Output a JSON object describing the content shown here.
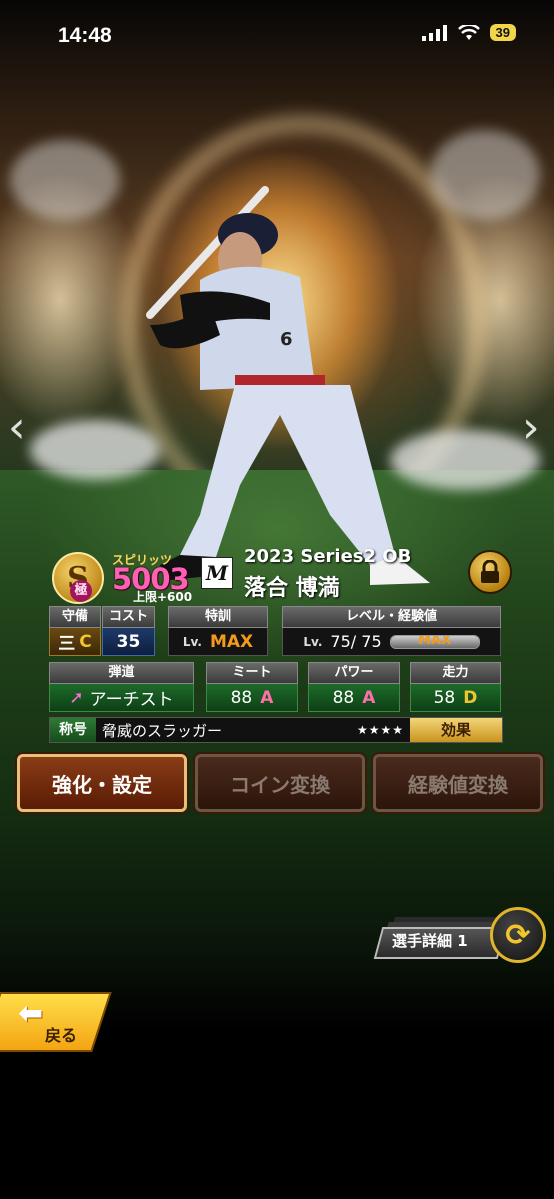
{
  "status_bar": {
    "time": "14:48",
    "battery": "39"
  },
  "player": {
    "rank": "S",
    "rank_sub": "極",
    "spirits_label": "スピリッツ",
    "spirits_value": "5003",
    "spirits_cap": "上限+600",
    "team_logo": "M",
    "series": "2023 Series2 OB",
    "name": "落合 博満"
  },
  "stats": {
    "position": {
      "header": "守備",
      "value": "三",
      "grade": "C"
    },
    "cost": {
      "header": "コスト",
      "value": "35"
    },
    "training": {
      "header": "特訓",
      "lv": "Lv.",
      "value": "MAX"
    },
    "level": {
      "header": "レベル・経験値",
      "lv": "Lv.",
      "value": "75/ 75",
      "bar_label": "MAX",
      "bar_fill": 1.0
    },
    "trajectory": {
      "header": "弾道",
      "value": "アーチスト"
    },
    "contact": {
      "header": "ミート",
      "value": "88",
      "grade": "A"
    },
    "power": {
      "header": "パワー",
      "value": "88",
      "grade": "A"
    },
    "speed": {
      "header": "走力",
      "value": "58",
      "grade": "D"
    }
  },
  "title_row": {
    "label": "称号",
    "text": "脅威のスラッガー",
    "stars": "★★★★",
    "effect": "効果"
  },
  "actions": {
    "enhance": "強化・設定",
    "coin": "コイン変換",
    "exp": "経験値変換"
  },
  "detail": {
    "label": "選手詳細 1"
  },
  "back": {
    "label": "戻る"
  },
  "colors": {
    "spirits": "#ff5fb5",
    "max": "#f39a1a",
    "grade_a": "#ff6fa8",
    "grade_c": "#f3c52c",
    "grade_d": "#f3c52c"
  }
}
